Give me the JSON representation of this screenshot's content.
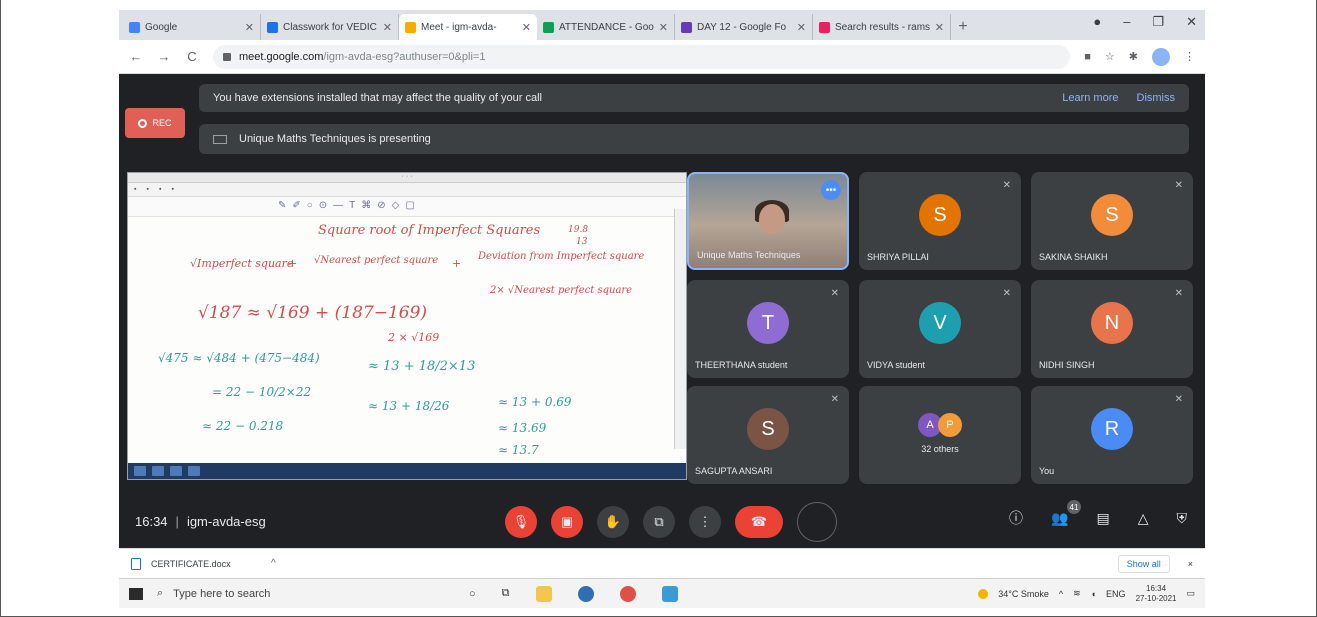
{
  "browser": {
    "tabs": [
      {
        "label": "Google",
        "color": "#4285f4"
      },
      {
        "label": "Classwork for VEDIC",
        "color": "#1a73e8"
      },
      {
        "label": "Meet - igm-avda-",
        "color": "#f9ab00",
        "active": true
      },
      {
        "label": "ATTENDANCE - Goo",
        "color": "#0f9d58"
      },
      {
        "label": "DAY 12 - Google Fo",
        "color": "#673ab7"
      },
      {
        "label": "Search results - rams",
        "color": "#e91e63"
      }
    ],
    "new_tab": "+",
    "url_host": "meet.google.com",
    "url_path": "/igm-avda-esg?authuser=0&pli=1"
  },
  "meet": {
    "extension_notice": "You have extensions installed that may affect the quality of your call",
    "learn_more": "Learn more",
    "dismiss": "Dismiss",
    "rec_label": "REC",
    "presenting_text": "Unique Maths Techniques is presenting",
    "participants": [
      {
        "name": "Unique Maths Techniques",
        "video": true
      },
      {
        "name": "SHRIYA PILLAI",
        "initial": "S",
        "color": "#e37400"
      },
      {
        "name": "SAKINA SHAIKH",
        "initial": "S",
        "color": "#f28b3a"
      },
      {
        "name": "THEERTHANA student",
        "initial": "T",
        "color": "#8e6cd1"
      },
      {
        "name": "VIDYA student",
        "initial": "V",
        "color": "#1e9fb0"
      },
      {
        "name": "NIDHI SINGH",
        "initial": "N",
        "color": "#e8744b"
      },
      {
        "name": "SAGUPTA ANSARI",
        "initial": "S",
        "color": "#7a5545"
      },
      {
        "name": "32 others",
        "avatars": [
          {
            "initial": "A",
            "color": "#7e57c2"
          },
          {
            "initial": "P",
            "color": "#f29b38"
          }
        ]
      },
      {
        "name": "You",
        "initial": "R",
        "color": "#4a8bf5"
      }
    ],
    "time": "16:34",
    "meeting_code": "igm-avda-esg",
    "participant_count": "41"
  },
  "whiteboard": {
    "heading": "Square root of Imperfect Squares",
    "formula_left": "√Imperfect square",
    "formula_mid": "√Nearest perfect square",
    "formula_right": "Deviation from Imperfect square",
    "formula_denominator": "2× √Nearest perfect square",
    "line1": "√187   ≈   √169  +  (187−169)",
    "line1_den": "2 × √169",
    "work_a": "√475 ≈ √484 + (475−484)",
    "work_b": "= 22 − 10/2×22",
    "work_c": "≈ 22 − 0.218",
    "work_d": "≈ 13 + 18/2×13",
    "work_e": "≈ 13 + 18/26",
    "work_f": "≈ 13 + 0.69",
    "work_g": "≈ 13.69",
    "work_h": "≈ 13.7",
    "side_a": "19.8",
    "side_b": "13"
  },
  "downloads": {
    "file_name": "CERTIFICATE.docx",
    "show_all": "Show all",
    "close": "×"
  },
  "taskbar": {
    "search_placeholder": "Type here to search",
    "weather": "34°C Smoke",
    "language": "ENG",
    "clock_time": "16:34",
    "clock_date": "27-10-2021"
  }
}
